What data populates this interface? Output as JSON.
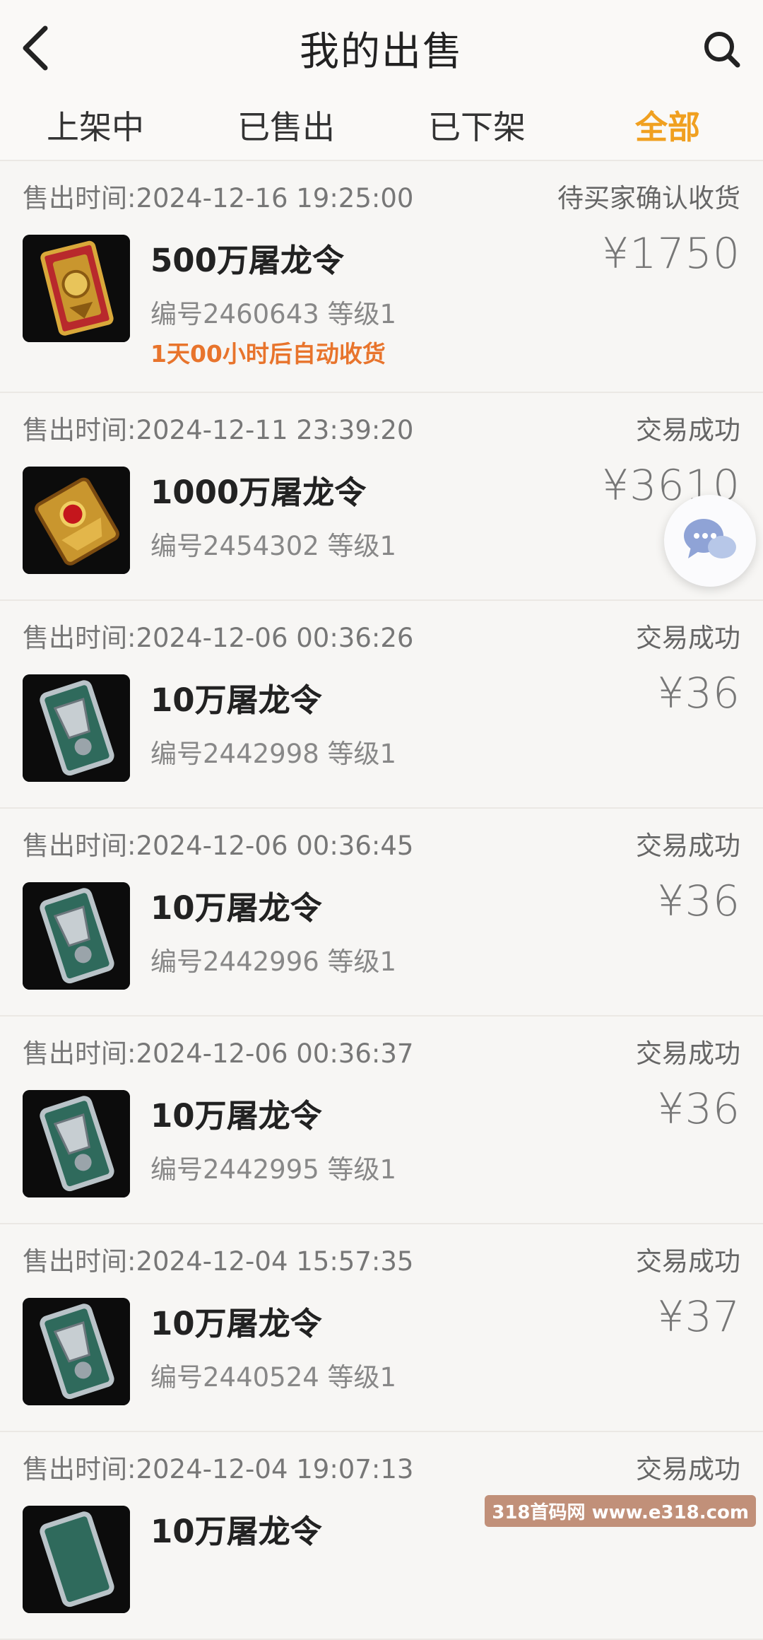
{
  "header": {
    "title": "我的出售",
    "back_icon": "chevron-left-icon",
    "search_icon": "search-icon"
  },
  "tabs": [
    {
      "label": "上架中",
      "active": false
    },
    {
      "label": "已售出",
      "active": false
    },
    {
      "label": "已下架",
      "active": false
    },
    {
      "label": "全部",
      "active": true
    }
  ],
  "colors": {
    "accent": "#f0a020",
    "note": "#e8742c"
  },
  "orders": [
    {
      "sold_time": "售出时间:2024-12-16 19:25:00",
      "status": "待买家确认收货",
      "name": "500万屠龙令",
      "meta": "编号2460643 等级1",
      "note": "1天00小时后自动收货",
      "price": "¥1750",
      "thumb": "red-gold-token"
    },
    {
      "sold_time": "售出时间:2024-12-11 23:39:20",
      "status": "交易成功",
      "name": "1000万屠龙令",
      "meta": "编号2454302 等级1",
      "note": "",
      "price": "¥3610",
      "thumb": "gold-ruby-token"
    },
    {
      "sold_time": "售出时间:2024-12-06 00:36:26",
      "status": "交易成功",
      "name": "10万屠龙令",
      "meta": "编号2442998 等级1",
      "note": "",
      "price": "¥36",
      "thumb": "silver-token"
    },
    {
      "sold_time": "售出时间:2024-12-06 00:36:45",
      "status": "交易成功",
      "name": "10万屠龙令",
      "meta": "编号2442996 等级1",
      "note": "",
      "price": "¥36",
      "thumb": "silver-token"
    },
    {
      "sold_time": "售出时间:2024-12-06 00:36:37",
      "status": "交易成功",
      "name": "10万屠龙令",
      "meta": "编号2442995 等级1",
      "note": "",
      "price": "¥36",
      "thumb": "silver-token"
    },
    {
      "sold_time": "售出时间:2024-12-04 15:57:35",
      "status": "交易成功",
      "name": "10万屠龙令",
      "meta": "编号2440524 等级1",
      "note": "",
      "price": "¥37",
      "thumb": "silver-token"
    },
    {
      "sold_time": "售出时间:2024-12-04 19:07:13",
      "status": "交易成功",
      "name": "10万屠龙令",
      "meta": "",
      "note": "",
      "price": "",
      "thumb": "silver-token"
    }
  ],
  "chat": {
    "icon": "chat-bubbles-icon"
  },
  "watermark": "318首码网 www.e318.com"
}
